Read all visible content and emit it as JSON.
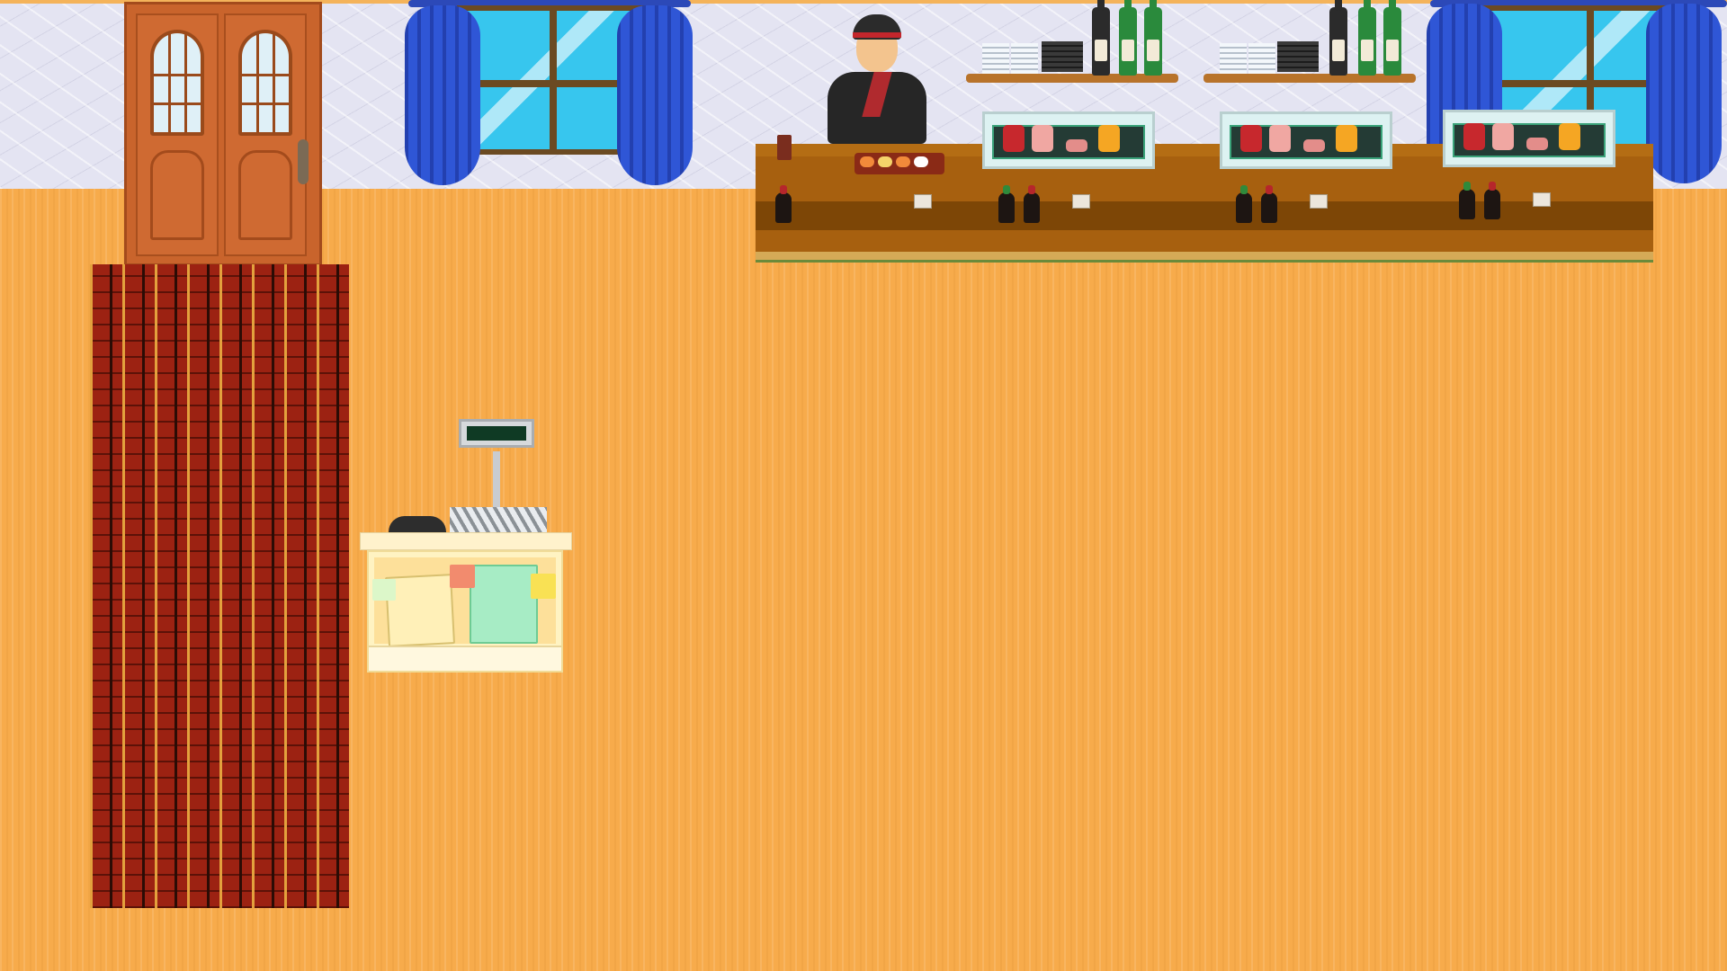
{
  "scene": {
    "name": "sushi-restaurant",
    "colors": {
      "wall": "#e4e4f2",
      "floor": "#f7ab4b",
      "door": "#c9642c",
      "rug": "#9c2212",
      "curtain": "#2f56d6",
      "window_glass": "#37c6ee",
      "counter": "#a7600f",
      "display_case": "#ddf2f2"
    },
    "objects": [
      {
        "name": "entrance-door",
        "interactable": true
      },
      {
        "name": "entrance-rug",
        "interactable": false
      },
      {
        "name": "window-left",
        "interactable": false
      },
      {
        "name": "window-right",
        "interactable": false
      },
      {
        "name": "sushi-chef",
        "interactable": true
      },
      {
        "name": "sushi-counter",
        "interactable": true
      },
      {
        "name": "cash-register",
        "interactable": true
      }
    ],
    "register_display": ""
  }
}
